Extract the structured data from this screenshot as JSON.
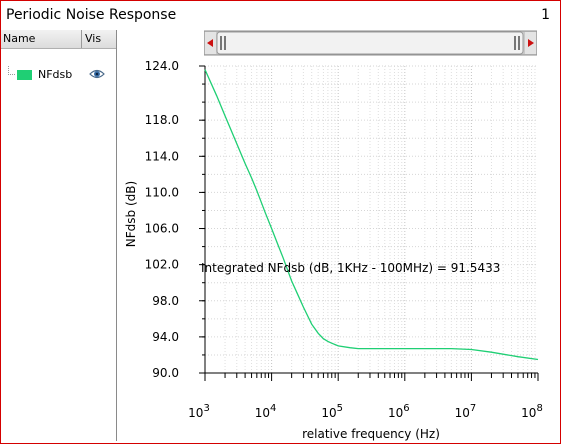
{
  "window": {
    "title": "Periodic Noise Response",
    "subwindow_number": "1"
  },
  "legend": {
    "col_name": "Name",
    "col_vis": "Vis",
    "items": [
      {
        "label": "NFdsb",
        "color": "#1fcf74",
        "icon": "eye-icon"
      }
    ]
  },
  "chart_data": {
    "type": "line",
    "xlabel": "relative frequency (Hz)",
    "ylabel": "NFdsb (dB)",
    "x_scale": "log",
    "xlim": [
      1000,
      100000000
    ],
    "ylim": [
      90.0,
      124.0
    ],
    "y_ticks": [
      "90.0",
      "94.0",
      "98.0",
      "102.0",
      "106.0",
      "110.0",
      "114.0",
      "118.0",
      "124.0"
    ],
    "y_tick_values": [
      90,
      94,
      98,
      102,
      106,
      110,
      114,
      118,
      124
    ],
    "x_ticks": [
      {
        "base": "10",
        "exp": "3"
      },
      {
        "base": "10",
        "exp": "4"
      },
      {
        "base": "10",
        "exp": "5"
      },
      {
        "base": "10",
        "exp": "6"
      },
      {
        "base": "10",
        "exp": "7"
      },
      {
        "base": "10",
        "exp": "8"
      }
    ],
    "x_tick_values": [
      1000,
      10000,
      100000,
      1000000,
      10000000,
      100000000
    ],
    "grid": true,
    "annotation": "Integrated NFdsb (dB, 1KHz - 100MHz) = 91.5433",
    "series": [
      {
        "name": "NFdsb",
        "color": "#1fcf74",
        "x": [
          1000,
          1500,
          2000,
          3000,
          4000,
          5000,
          6000,
          7000,
          8000,
          10000,
          12000,
          15000,
          20000,
          25000,
          30000,
          40000,
          50000,
          60000,
          70000,
          80000,
          100000,
          150000,
          200000,
          300000,
          500000,
          1000000,
          2000000,
          5000000,
          10000000,
          20000000,
          50000000,
          100000000
        ],
        "y": [
          123.6,
          120.7,
          118.5,
          115.4,
          113.2,
          111.6,
          110.2,
          108.9,
          107.8,
          106.0,
          104.5,
          102.7,
          100.2,
          98.6,
          97.3,
          95.4,
          94.4,
          93.8,
          93.5,
          93.3,
          93.0,
          92.8,
          92.7,
          92.7,
          92.7,
          92.7,
          92.7,
          92.7,
          92.6,
          92.3,
          91.8,
          91.5
        ]
      }
    ]
  }
}
